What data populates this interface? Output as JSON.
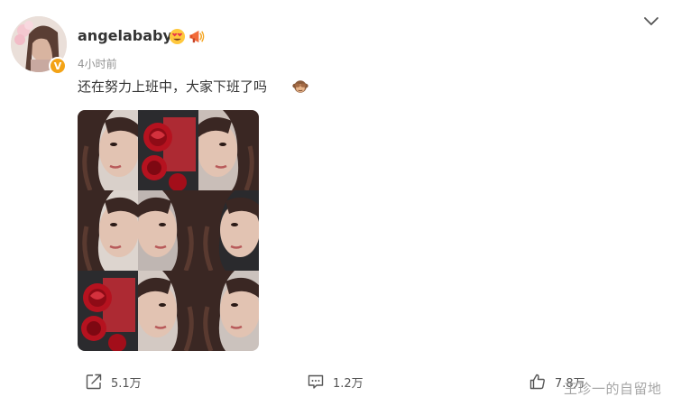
{
  "post": {
    "username": "angelababy",
    "timestamp": "4小时前",
    "text": "还在努力上班中，大家下班了吗",
    "verified_badge": "V",
    "emojis": [
      "heart-eyes-emoji",
      "megaphone-emoji",
      "see-no-evil-monkey-emoji"
    ]
  },
  "photos": {
    "count": 9,
    "alt": [
      "selfie",
      "rose",
      "selfie",
      "selfie",
      "selfie",
      "selfie",
      "rose",
      "selfie",
      "selfie"
    ]
  },
  "actions": {
    "repost_count": "5.1万",
    "comment_count": "1.2万",
    "like_count": "7.8万"
  },
  "watermark": "王珍一的自留地",
  "colors": {
    "text": "#333333",
    "muted": "#939393",
    "badge": "#f3a316",
    "rose": "#c81e2a"
  }
}
